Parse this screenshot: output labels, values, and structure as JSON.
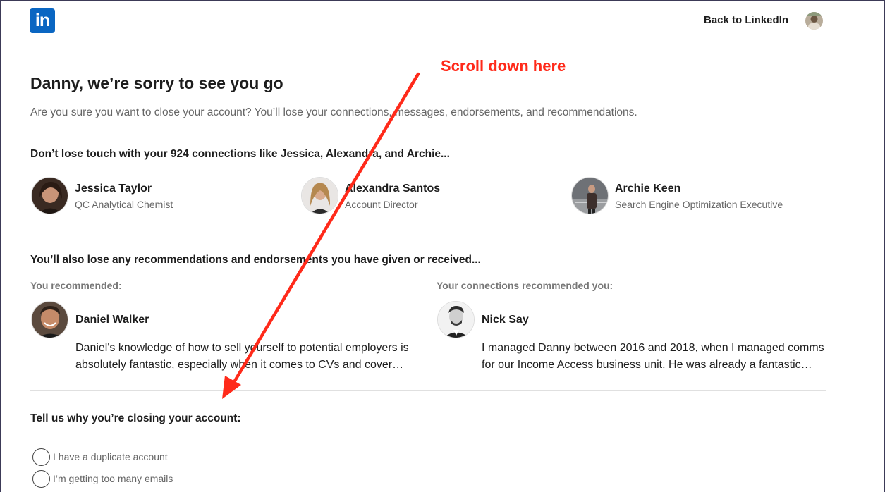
{
  "header": {
    "logo_text": "in",
    "back_link": "Back to LinkedIn"
  },
  "page": {
    "title": "Danny, we’re sorry to see you go",
    "subtitle": "Are you sure you want to close your account? You’ll lose your connections, messages, endorsements, and recommendations."
  },
  "connections": {
    "heading": "Don’t lose touch with your 924 connections like Jessica, Alexandra, and Archie...",
    "people": [
      {
        "name": "Jessica Taylor",
        "title": "QC Analytical Chemist"
      },
      {
        "name": "Alexandra Santos",
        "title": "Account Director"
      },
      {
        "name": "Archie Keen",
        "title": "Search Engine Optimization Executive"
      }
    ]
  },
  "recommendations": {
    "heading": "You’ll also lose any recommendations and endorsements you have given or received...",
    "given": {
      "label": "You recommended:",
      "name": "Daniel Walker",
      "text_line1": "Daniel's knowledge of how to sell yourself to potential employers is",
      "text_line2": "absolutely fantastic, especially when it comes to CVs and cover…"
    },
    "received": {
      "label": "Your connections recommended you:",
      "name": "Nick Say",
      "text_line1": "I managed Danny between 2016 and 2018, when I managed comms",
      "text_line2": "for our Income Access business unit. He was already a fantastic…"
    }
  },
  "reasons": {
    "heading": "Tell us why you’re closing your account:",
    "options": [
      {
        "label": "I have a duplicate account"
      },
      {
        "label": "I’m getting too many emails"
      }
    ]
  },
  "annotation": {
    "text": "Scroll down here",
    "color": "#ff2a1a"
  },
  "colors": {
    "brand": "#0a66c2",
    "text": "#1d1d1d",
    "muted": "#666666"
  }
}
